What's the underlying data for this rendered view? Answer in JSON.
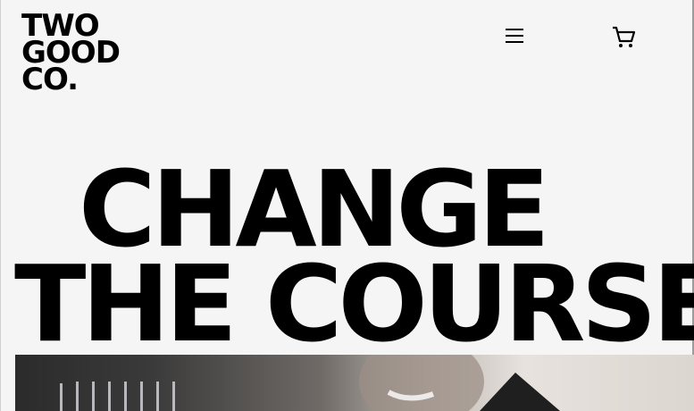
{
  "brand": {
    "logo_lines": [
      "TWO",
      "GOOD",
      "CO."
    ]
  },
  "header": {
    "menu_icon": "hamburger-menu-icon",
    "cart_icon": "shopping-cart-icon"
  },
  "hero": {
    "title_lines": [
      "CHANGE",
      "THE COURSE"
    ]
  },
  "colors": {
    "background": "#f5f5f5",
    "text": "#000000"
  }
}
